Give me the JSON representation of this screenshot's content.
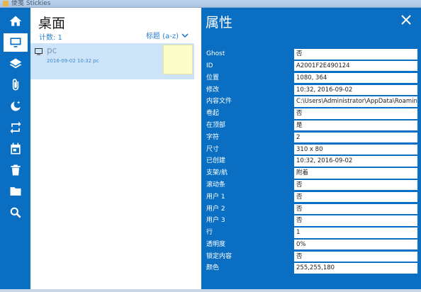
{
  "window": {
    "title": "便笺 Stickies"
  },
  "sidebar": {
    "items": [
      {
        "name": "home-icon"
      },
      {
        "name": "monitor-icon"
      },
      {
        "name": "layers-icon"
      },
      {
        "name": "paperclip-icon"
      },
      {
        "name": "moon-star-icon"
      },
      {
        "name": "repeat-icon"
      },
      {
        "name": "calendar-icon"
      },
      {
        "name": "trash-icon"
      },
      {
        "name": "folder-icon"
      },
      {
        "name": "search-icon"
      }
    ],
    "active_index": 1
  },
  "list": {
    "title": "桌面",
    "count": "计数: 1",
    "sort_label": "标题 (a-z)",
    "notes": [
      {
        "name": "pc",
        "date": "2016-09-02 10:32 pc"
      }
    ]
  },
  "properties": {
    "title": "属性",
    "rows": [
      {
        "key": "Ghost",
        "value": "否"
      },
      {
        "key": "ID",
        "value": "A2001F2E490124"
      },
      {
        "key": "位置",
        "value": "1080, 364"
      },
      {
        "key": "修改",
        "value": "10:32, 2016-09-02"
      },
      {
        "key": "内容文件",
        "value": "C:\\Users\\Administrator\\AppData\\Roaming"
      },
      {
        "key": "卷起",
        "value": "否"
      },
      {
        "key": "在顶部",
        "value": "是"
      },
      {
        "key": "字符",
        "value": "2"
      },
      {
        "key": "尺寸",
        "value": "310 x 80"
      },
      {
        "key": "已创建",
        "value": "10:32, 2016-09-02"
      },
      {
        "key": "支架/航",
        "value": "附着"
      },
      {
        "key": "滚动条",
        "value": "否"
      },
      {
        "key": "用户 1",
        "value": "否"
      },
      {
        "key": "用户 2",
        "value": "否"
      },
      {
        "key": "用户 3",
        "value": "否"
      },
      {
        "key": "行",
        "value": "1"
      },
      {
        "key": "透明度",
        "value": "0%"
      },
      {
        "key": "锁定内容",
        "value": "否"
      },
      {
        "key": "颜色",
        "value": "255,255,180"
      }
    ]
  },
  "colors": {
    "accent": "#0a6fc2",
    "selection": "#cde3f7",
    "note": "#fdfdc9"
  }
}
